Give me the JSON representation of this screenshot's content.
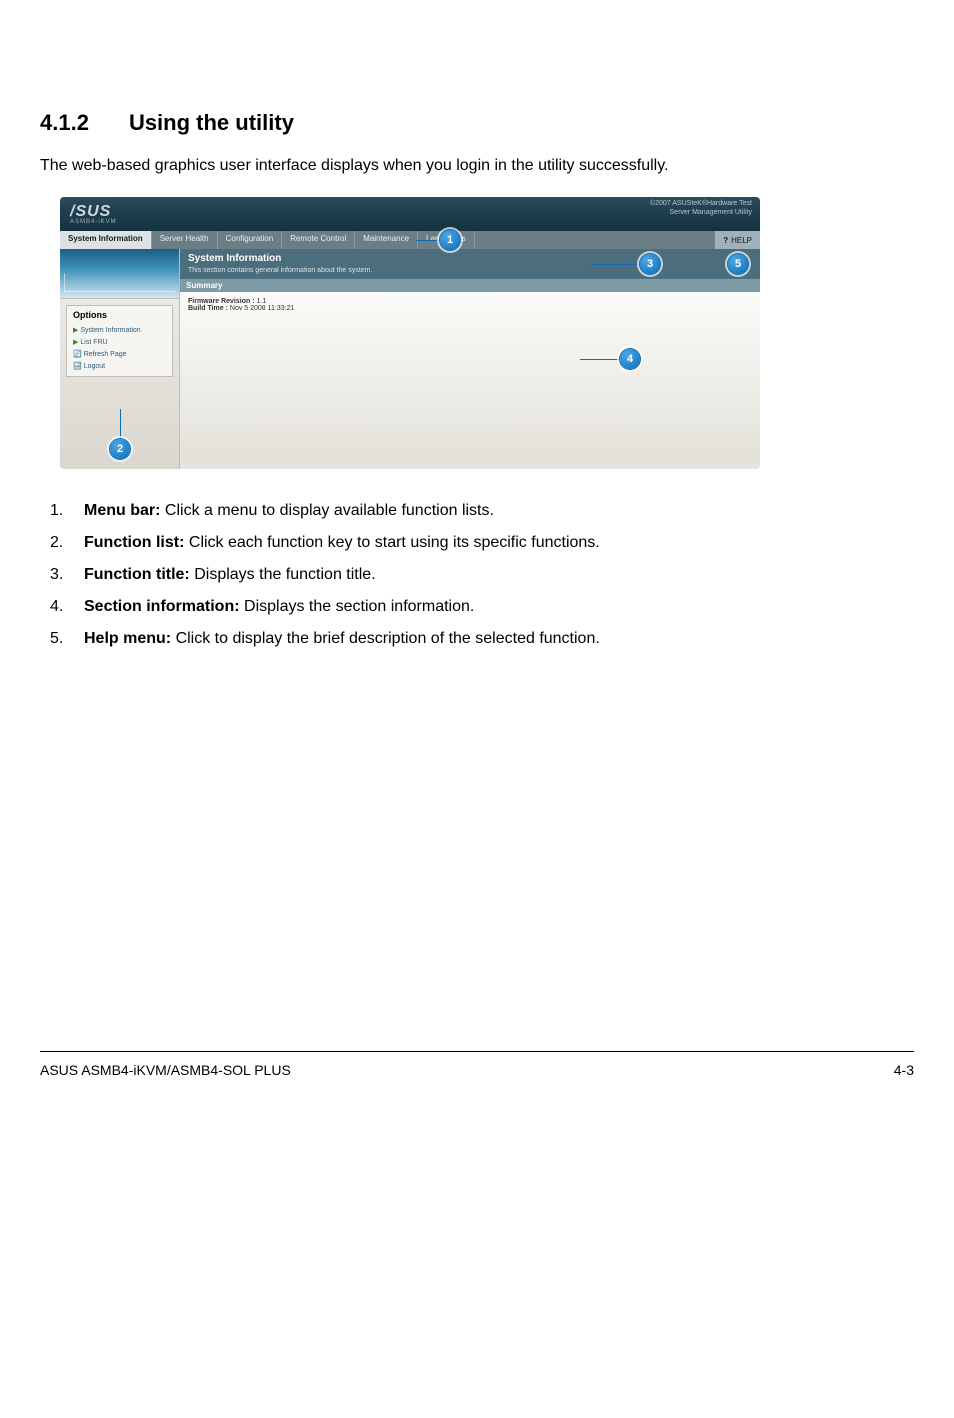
{
  "heading": {
    "number": "4.1.2",
    "title": "Using the utility"
  },
  "intro": "The web-based graphics user interface displays when you login in the utility successfully.",
  "screenshot": {
    "logo": "/SUS",
    "sublogo": "ASMB4-iKVM",
    "corner_line1": "©2007 ASUSteK®Hardware Test",
    "corner_line2": "Server Management Utility",
    "menubar": {
      "items": [
        {
          "label": "System Information",
          "active": true
        },
        {
          "label": "Server Health",
          "active": false
        },
        {
          "label": "Configuration",
          "active": false
        },
        {
          "label": "Remote Control",
          "active": false
        },
        {
          "label": "Maintenance",
          "active": false
        },
        {
          "label": "Languages",
          "active": false
        }
      ],
      "help_icon": "?",
      "help_label": "HELP"
    },
    "sidebar": {
      "heading": "Options",
      "items": [
        {
          "label": "System Information"
        },
        {
          "label": "List FRU"
        },
        {
          "label": "Refresh Page"
        },
        {
          "label": "Logout"
        }
      ]
    },
    "function_title": {
      "title": "System Information",
      "subtitle": "This section contains general information about the system."
    },
    "summary_label": "Summary",
    "content": {
      "line1_label": "Firmware Revision :",
      "line1_value": "1.1",
      "line2_label": "Build Time :",
      "line2_value": "Nov 5 2008 11:33:21"
    },
    "callouts": {
      "c1": "1",
      "c2": "2",
      "c3": "3",
      "c4": "4",
      "c5": "5"
    }
  },
  "legend": [
    {
      "num": "1.",
      "bold": "Menu bar:",
      "rest": " Click a menu to display available function lists."
    },
    {
      "num": "2.",
      "bold": "Function list:",
      "rest": " Click each function key to start using its specific functions."
    },
    {
      "num": "3.",
      "bold": "Function title:",
      "rest": " Displays the function title."
    },
    {
      "num": "4.",
      "bold": "Section information:",
      "rest": " Displays the section information."
    },
    {
      "num": "5.",
      "bold": "Help menu:",
      "rest": " Click to display the brief description of the selected function."
    }
  ],
  "footer": {
    "left": "ASUS ASMB4-iKVM/ASMB4-SOL PLUS",
    "right": "4-3"
  }
}
